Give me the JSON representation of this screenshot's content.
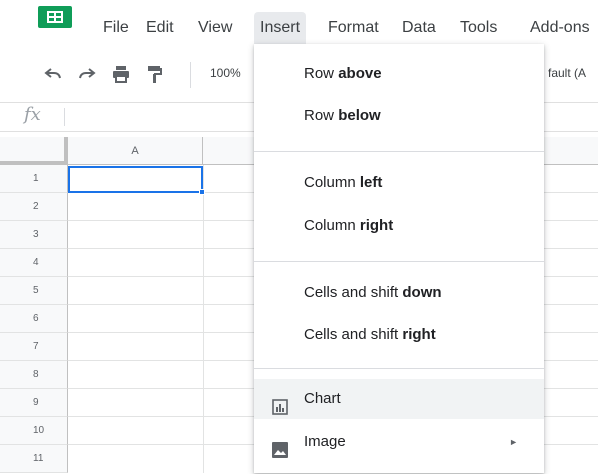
{
  "menubar": {
    "items": [
      {
        "label": "File"
      },
      {
        "label": "Edit"
      },
      {
        "label": "View"
      },
      {
        "label": "Insert"
      },
      {
        "label": "Format"
      },
      {
        "label": "Data"
      },
      {
        "label": "Tools"
      },
      {
        "label": "Add-ons"
      }
    ],
    "active": "Insert"
  },
  "toolbar": {
    "zoom": "100%",
    "font": "fault (A"
  },
  "formula_bar": {
    "fx": "fx"
  },
  "grid": {
    "column_headers": [
      "A"
    ],
    "rows": [
      "1",
      "2",
      "3",
      "4",
      "5",
      "6",
      "7",
      "8",
      "9",
      "10",
      "11"
    ],
    "selected_cell": "A1"
  },
  "insert_menu": {
    "row_above": {
      "prefix": "Row ",
      "bold": "above"
    },
    "row_below": {
      "prefix": "Row ",
      "bold": "below"
    },
    "column_left": {
      "prefix": "Column ",
      "bold": "left"
    },
    "column_right": {
      "prefix": "Column ",
      "bold": "right"
    },
    "cells_down": {
      "prefix": "Cells and shift ",
      "bold": "down"
    },
    "cells_right": {
      "prefix": "Cells and shift ",
      "bold": "right"
    },
    "chart": {
      "label": "Chart",
      "icon": "chart-icon"
    },
    "image": {
      "label": "Image",
      "icon": "image-icon",
      "submenu_arrow": "►"
    }
  },
  "colors": {
    "accent": "#1a73e8",
    "sheets_green": "#0f9d58",
    "menu_active_bg": "#e8eaed"
  }
}
